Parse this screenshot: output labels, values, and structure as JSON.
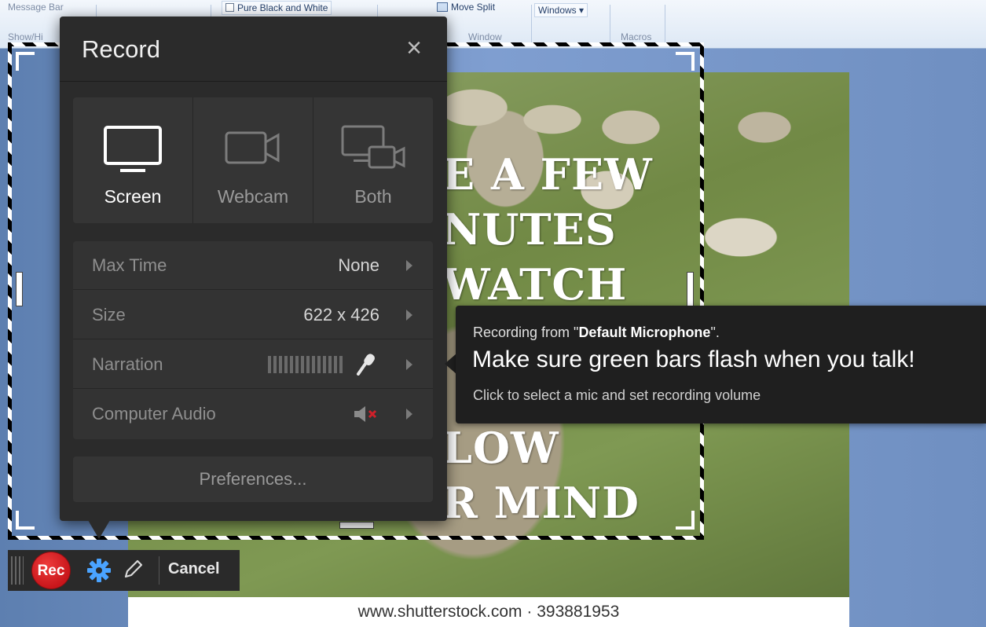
{
  "ribbon": {
    "message_bar": "Message Bar",
    "show_hide": "Show/Hi",
    "pure_bw": "Pure Black and White",
    "move_split": "Move Split",
    "windows": "Windows",
    "window_group": "Window",
    "macros_group": "Macros"
  },
  "photo": {
    "lines": [
      "E A FEW",
      "NUTES",
      "WATCH",
      "LOW",
      "R MIND"
    ],
    "watermark": "www.shutterstock.com · 393881953"
  },
  "panel": {
    "title": "Record",
    "close_icon": "close-icon",
    "modes": [
      {
        "label": "Screen",
        "icon": "monitor-icon",
        "active": true
      },
      {
        "label": "Webcam",
        "icon": "webcam-icon",
        "active": false
      },
      {
        "label": "Both",
        "icon": "screen-and-webcam-icon",
        "active": false
      }
    ],
    "settings": {
      "max_time": {
        "label": "Max Time",
        "value": "None"
      },
      "size": {
        "label": "Size",
        "value": "622 x 426"
      },
      "narration": {
        "label": "Narration",
        "icon": "microphone-icon"
      },
      "computer_audio": {
        "label": "Computer Audio",
        "icon": "speaker-muted-icon"
      }
    },
    "preferences": "Preferences..."
  },
  "tooltip": {
    "line1_prefix": "Recording from \"",
    "line1_device": "Default Microphone",
    "line1_suffix": "\".",
    "line2": "Make sure green bars flash when you talk!",
    "line3": "Click to select a mic and set recording volume"
  },
  "toolbar": {
    "rec": "Rec",
    "cancel": "Cancel",
    "icons": [
      "gear-icon",
      "pencil-icon"
    ]
  },
  "colors": {
    "rec_red": "#c8161b",
    "panel_bg": "#2b2b2b",
    "tooltip_bg": "#1f1f1f",
    "muted_x": "#d0202a"
  }
}
